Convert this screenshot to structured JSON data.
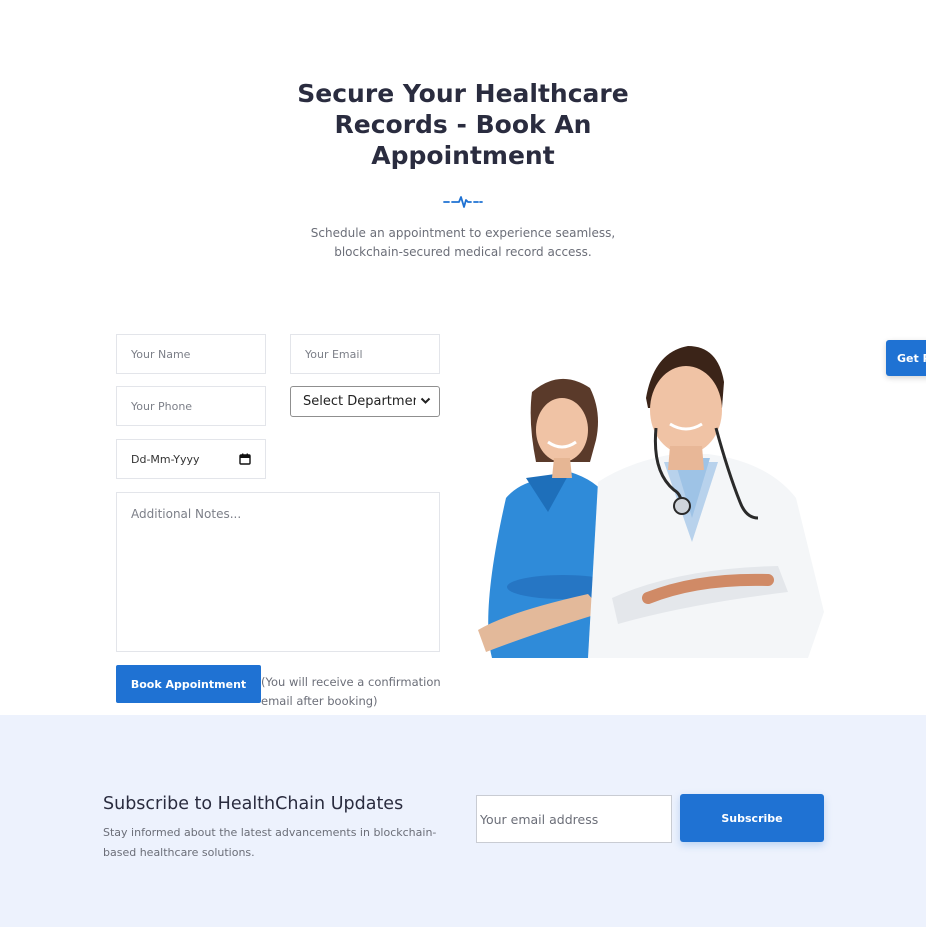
{
  "hero": {
    "title_line1": "Secure Your Healthcare",
    "title_line2": "Records - Book An",
    "title_line3": "Appointment",
    "subtitle_line1": "Schedule an appointment to experience seamless,",
    "subtitle_line2": "blockchain-secured medical record access.",
    "divider_icon": "heartbeat-pulse-icon"
  },
  "form": {
    "name_placeholder": "Your Name",
    "email_placeholder": "Your Email",
    "phone_placeholder": "Your Phone",
    "department_selected": "Select Department",
    "date_placeholder": "Dd-Mm-Yyyy",
    "notes_placeholder": "Additional Notes...",
    "submit_label": "Book Appointment",
    "note": "(You will receive a confirmation email after booking)"
  },
  "side_tab": {
    "label": "Get P"
  },
  "subscribe": {
    "title": "Subscribe to HealthChain Updates",
    "description": "Stay informed about the latest advancements in blockchain-based healthcare solutions.",
    "email_placeholder": "Your email address",
    "button_label": "Subscribe"
  },
  "colors": {
    "accent": "#1f72d3",
    "heading": "#2a2c3f",
    "band_background": "#edf2fd"
  }
}
